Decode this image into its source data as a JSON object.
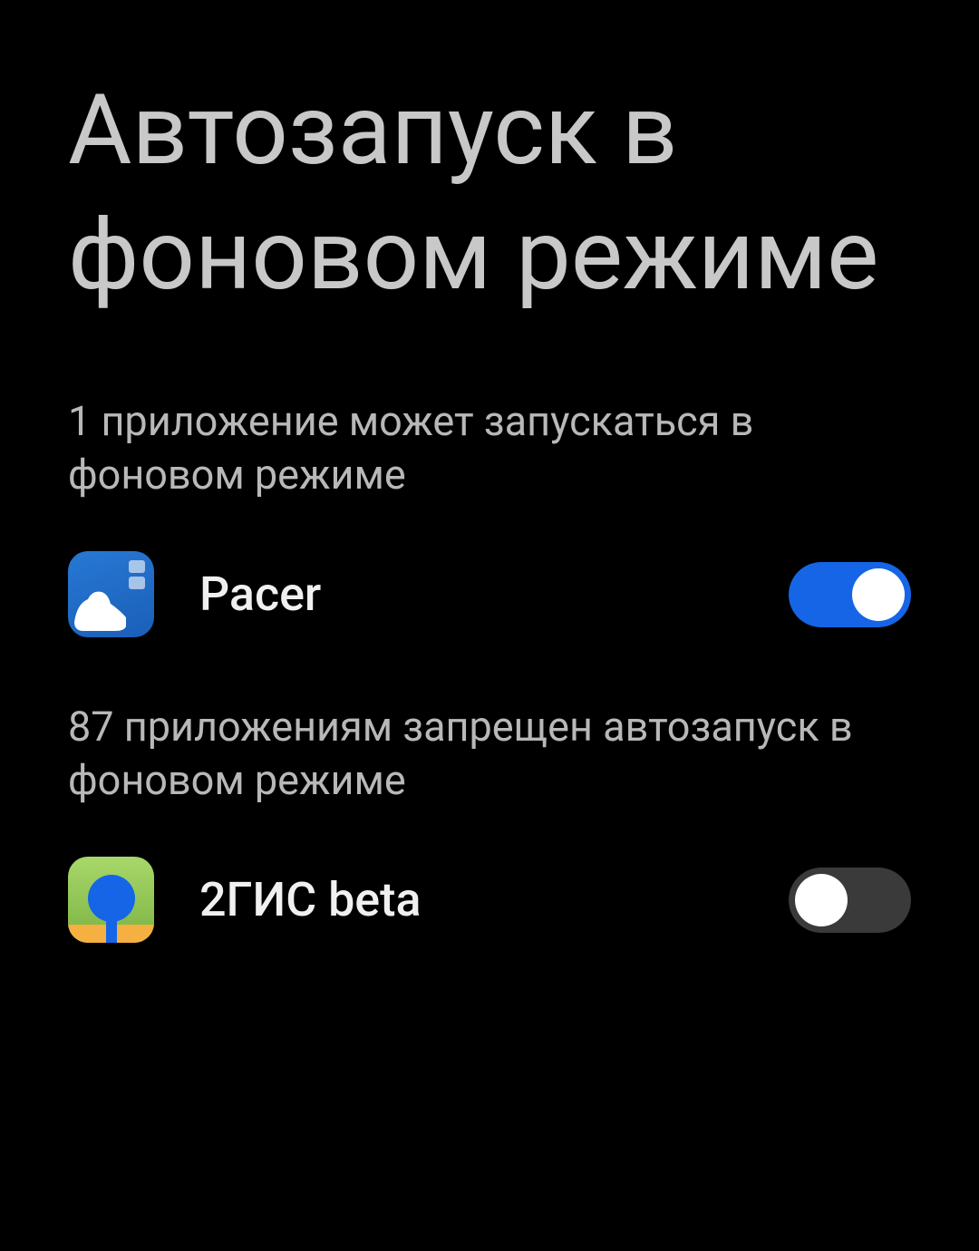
{
  "title": "Автозапуск в фоновом режиме",
  "sections": {
    "allowed": {
      "label": "1 приложение может запускаться в фоновом режиме",
      "count": 1
    },
    "denied": {
      "label": "87 приложениям запрещен автозапуск в фоновом режиме",
      "count": 87
    }
  },
  "apps": {
    "pacer": {
      "name": "Pacer",
      "enabled": true
    },
    "gis": {
      "name": "2ГИС beta",
      "enabled": false
    }
  }
}
